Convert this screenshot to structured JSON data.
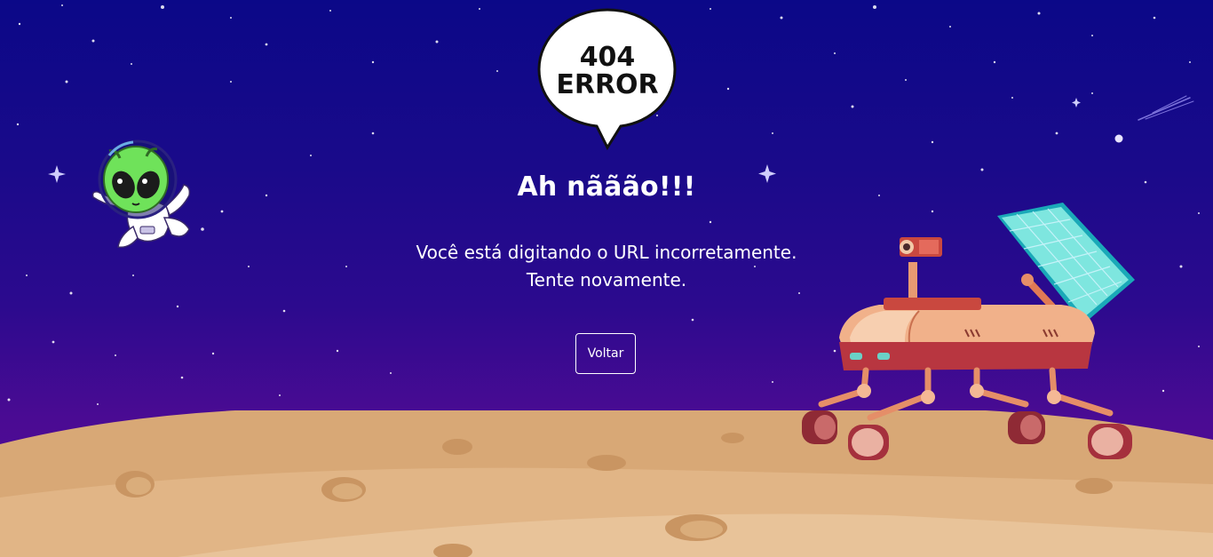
{
  "bubble": {
    "line1": "404",
    "line2": "ERROR"
  },
  "main": {
    "title": "Ah nããão!!!",
    "message_line1": "Você está digitando o URL incorretamente.",
    "message_line2": "Tente novamente.",
    "back_button_label": "Voltar"
  },
  "icons": {
    "alien": "alien-astronaut-icon",
    "rover": "mars-rover-icon",
    "bubble": "speech-bubble-icon",
    "comet": "comet-icon"
  },
  "colors": {
    "sky_top": "#0b0888",
    "sky_bottom": "#5a0c96",
    "ground": "#dcae7d",
    "text": "#ffffff"
  }
}
